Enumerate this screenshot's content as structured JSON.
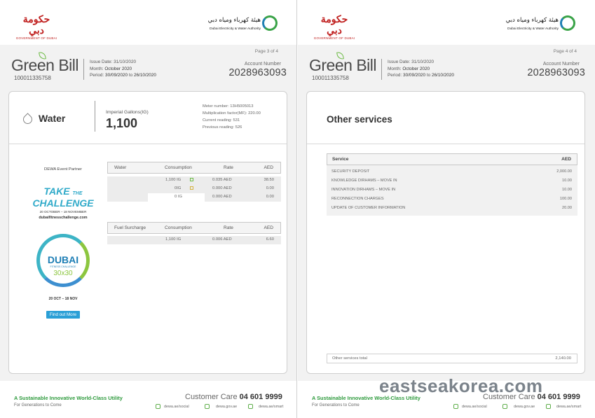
{
  "left": {
    "header": {
      "gov_logo_arabic": "حكومة دبي",
      "gov_logo_latin": "GOVERNMENT OF DUBAI",
      "dewa_logo_arabic": "هيئة كهرباء ومياه دبي",
      "dewa_logo_english": "Dubai Electricity & Water Authority"
    },
    "bill": {
      "title": "Green Bill",
      "bill_number": "100011335758",
      "issue_date_label": "Issue Date:",
      "issue_date": "31/10/2020",
      "month_label": "Month:",
      "month": "October 2020",
      "period_label": "Period:",
      "period_from": "30/09/2020",
      "period_to_word": "to",
      "period_to": "26/10/2020",
      "page": "Page 3 of 4",
      "account_label": "Account Number",
      "account_number": "2028963093"
    },
    "water": {
      "title": "Water",
      "unit_label": "Imperial Gallons(IG)",
      "consumption": "1,100",
      "meter_number": "Meter number: 13H5005013",
      "multiplication_factor": "Multiplication factor(MF): 220.00",
      "current_reading": "Current reading: 531",
      "previous_reading": "Previous reading: 526"
    },
    "promo": {
      "partner": "DEWA Event Partner",
      "take": "TAKE",
      "the": "THE",
      "challenge": "CHALLENGE",
      "dates": "20 OCTOBER – 18 NOVEMBER",
      "url": "dubaifitnesschallenge.com",
      "ring_title": "DUBAI",
      "ring_sub": "FITNESS CHALLENGE",
      "ring_num": "30x30",
      "dates2": "20 OCT – 18 NOV",
      "button": "Find out More"
    },
    "water_table": {
      "headers": [
        "Water",
        "Consumption",
        "Rate",
        "AED"
      ],
      "rows": [
        {
          "consumption": "1,100 IG",
          "rate": "0.035 AED",
          "aed": "38.50",
          "status": "green"
        },
        {
          "consumption": "0IG",
          "rate": "0.000 AED",
          "aed": "0.00",
          "status": "amber"
        },
        {
          "consumption": "0 IG",
          "rate": "0.000 AED",
          "aed": "0.00",
          "status": ""
        }
      ]
    },
    "fuel_table": {
      "headers": [
        "Fuel Surcharge",
        "Consumption",
        "Rate",
        "AED"
      ],
      "rows": [
        {
          "consumption": "1,100 IG",
          "rate": "0.006 AED",
          "aed": "6.60"
        }
      ]
    },
    "footer": {
      "tagline": "A Sustainable Innovative World-Class Utility",
      "sub": "For Generations to Come",
      "customer_care": "Customer Care",
      "phone": "04 601 9999",
      "social": "dewa.ae/social",
      "site": "dewa.gov.ae",
      "smart": "dewa.ae/smart"
    }
  },
  "right": {
    "header": {
      "gov_logo_arabic": "حكومة دبي",
      "gov_logo_latin": "GOVERNMENT OF DUBAI",
      "dewa_logo_arabic": "هيئة كهرباء ومياه دبي",
      "dewa_logo_english": "Dubai Electricity & Water Authority"
    },
    "bill": {
      "title": "Green Bill",
      "bill_number": "100011335758",
      "issue_date_label": "Issue Date:",
      "issue_date": "31/10/2020",
      "month_label": "Month:",
      "month": "October 2020",
      "period_label": "Period:",
      "period_from": "30/09/2020",
      "period_to_word": "to",
      "period_to": "26/10/2020",
      "page": "Page 4 of 4",
      "account_label": "Account Number",
      "account_number": "2028963093"
    },
    "other": {
      "title": "Other services",
      "headers": [
        "Service",
        "AED"
      ],
      "rows": [
        {
          "service": "SECURITY DEPOSIT",
          "aed": "2,000.00"
        },
        {
          "service": "KNOWLEDGE DIRHAMS – MOVE IN",
          "aed": "10.00"
        },
        {
          "service": "INNOVATION DIRHAMS – MOVE IN",
          "aed": "10.00"
        },
        {
          "service": "RECONNECTION CHARGES",
          "aed": "100.00"
        },
        {
          "service": "UPDATE OF CUSTOMER INFORMATION",
          "aed": "20.00"
        }
      ],
      "total_label": "Other services total",
      "total": "2,140.00"
    },
    "footer": {
      "tagline": "A Sustainable Innovative World-Class Utility",
      "sub": "For Generations to Come",
      "customer_care": "Customer Care",
      "phone": "04 601 9999",
      "social": "dewa.ae/social",
      "site": "dewa.gov.ae",
      "smart": "dewa.ae/smart"
    }
  },
  "watermark": "eastseakorea.com",
  "colors": {
    "brand_green": "#2d9a3c",
    "gov_red": "#c0201f",
    "accent_blue": "#2a9fd6",
    "text_dark": "#333333"
  }
}
